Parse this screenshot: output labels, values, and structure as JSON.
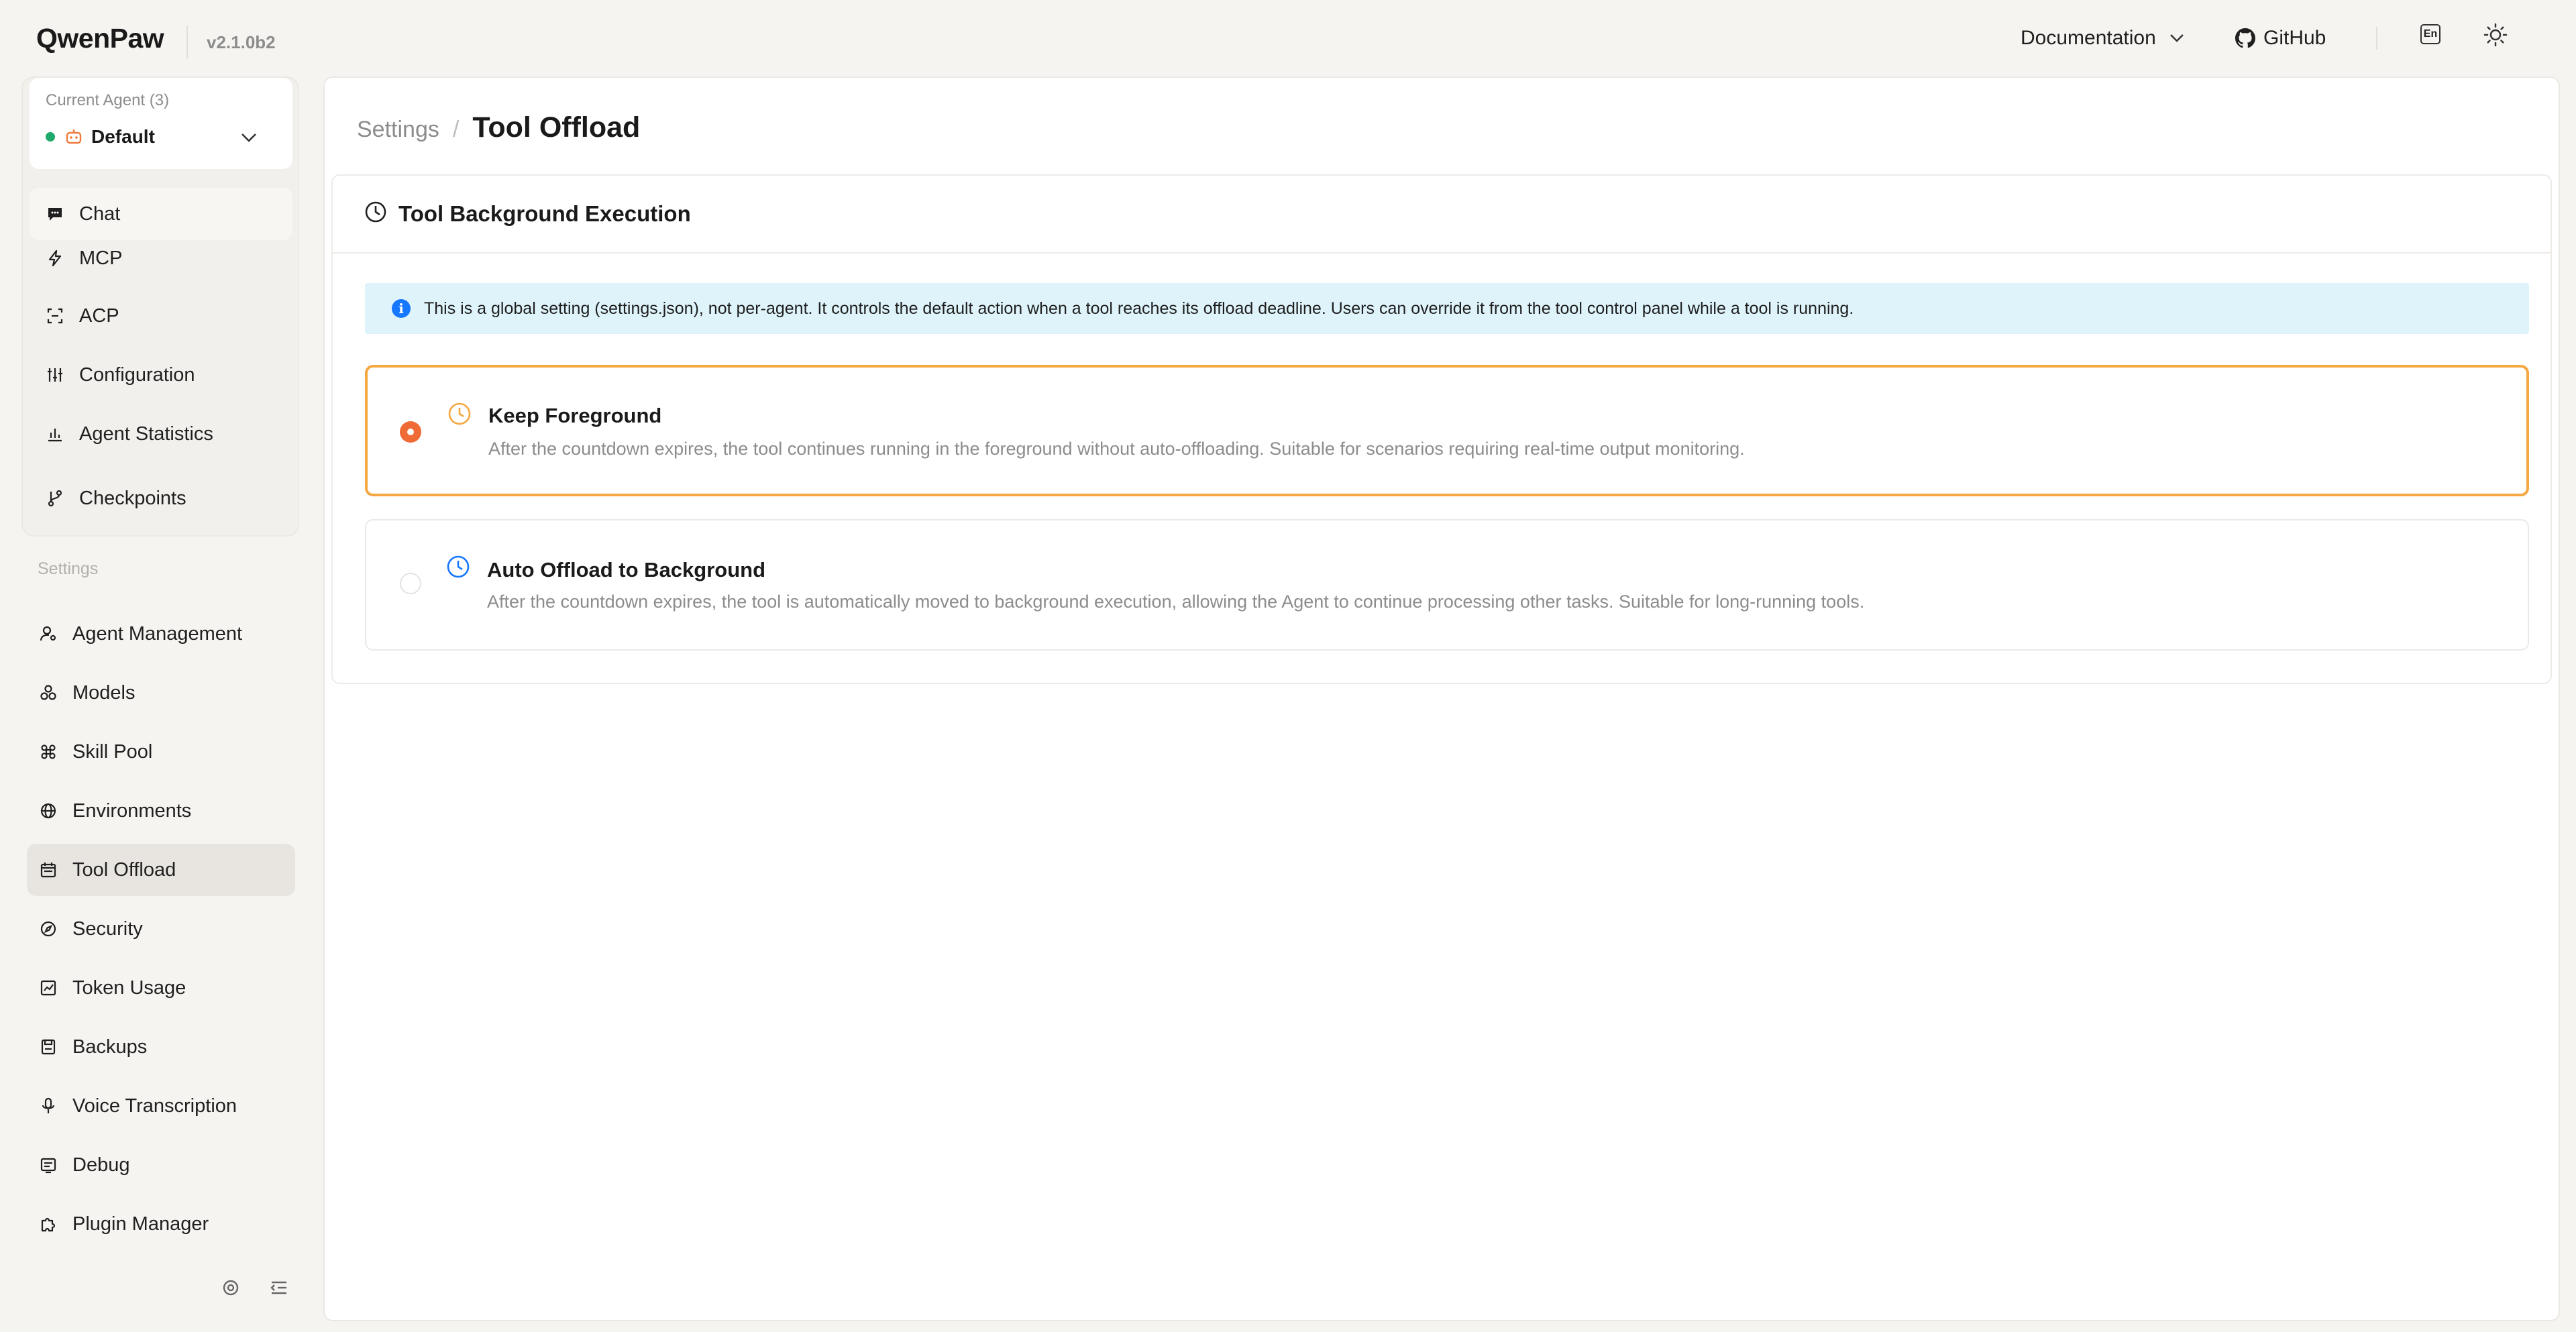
{
  "header": {
    "logo": "QwenPaw",
    "version": "v2.1.0b2",
    "documentation_label": "Documentation",
    "github_label": "GitHub",
    "language_label": "En"
  },
  "sidebar": {
    "agent_caption": "Current Agent (3)",
    "agent_name": "Default",
    "agent_nav": [
      {
        "label": "Chat",
        "icon": "chat-icon"
      },
      {
        "label": "MCP",
        "icon": "lightning-icon"
      },
      {
        "label": "ACP",
        "icon": "acp-icon"
      },
      {
        "label": "Configuration",
        "icon": "sliders-icon"
      },
      {
        "label": "Agent Statistics",
        "icon": "bar-chart-icon"
      },
      {
        "label": "Checkpoints",
        "icon": "git-branch-icon"
      }
    ],
    "section_label": "Settings",
    "settings_nav": [
      {
        "label": "Agent Management",
        "icon": "user-gear-icon"
      },
      {
        "label": "Models",
        "icon": "models-icon"
      },
      {
        "label": "Skill Pool",
        "icon": "command-icon"
      },
      {
        "label": "Environments",
        "icon": "globe-icon"
      },
      {
        "label": "Tool Offload",
        "icon": "calendar-icon"
      },
      {
        "label": "Security",
        "icon": "compass-icon"
      },
      {
        "label": "Token Usage",
        "icon": "line-chart-icon"
      },
      {
        "label": "Backups",
        "icon": "save-icon"
      },
      {
        "label": "Voice Transcription",
        "icon": "microphone-icon"
      },
      {
        "label": "Debug",
        "icon": "debug-icon"
      },
      {
        "label": "Plugin Manager",
        "icon": "puzzle-icon"
      }
    ]
  },
  "main": {
    "breadcrumb_parent": "Settings",
    "breadcrumb_separator": "/",
    "breadcrumb_current": "Tool Offload",
    "card_title": "Tool Background Execution",
    "info_text": "This is a global setting (settings.json), not per-agent. It controls the default action when a tool reaches its offload deadline. Users can override it from the tool control panel while a tool is running.",
    "options": [
      {
        "title": "Keep Foreground",
        "description": "After the countdown expires, the tool continues running in the foreground without auto-offloading. Suitable for scenarios requiring real-time output monitoring.",
        "selected": true
      },
      {
        "title": "Auto Offload to Background",
        "description": "After the countdown expires, the tool is automatically moved to background execution, allowing the Agent to continue processing other tasks. Suitable for long-running tools.",
        "selected": false
      }
    ]
  },
  "colors": {
    "accent": "#f06a35",
    "selected_border": "#f5a742",
    "info_bg": "#def3fa",
    "info_icon": "#1677ff",
    "status_green": "#1faa6b"
  }
}
